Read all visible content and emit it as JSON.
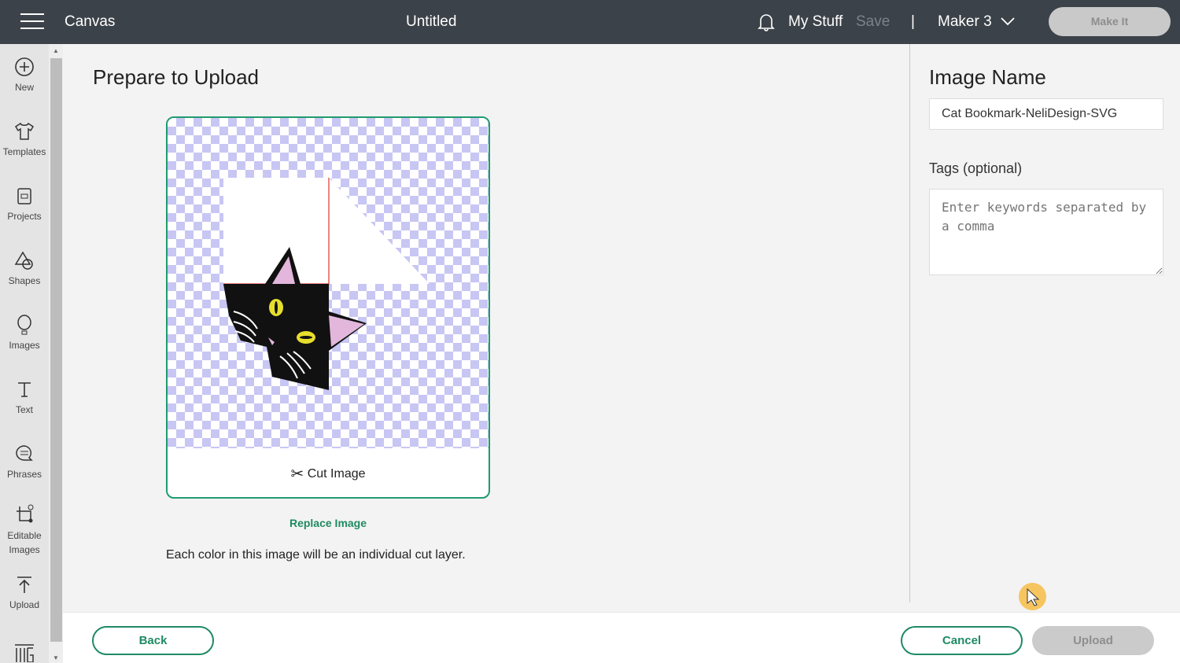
{
  "topbar": {
    "menu_icon": "hamburger-icon",
    "app": "Canvas",
    "title": "Untitled",
    "my_stuff": "My Stuff",
    "save": "Save",
    "separator": "|",
    "machine": "Maker 3",
    "make_it": "Make It"
  },
  "sidebar": {
    "items": [
      {
        "label": "New",
        "icon": "plus-circle-icon"
      },
      {
        "label": "Templates",
        "icon": "shirt-icon"
      },
      {
        "label": "Projects",
        "icon": "projects-icon"
      },
      {
        "label": "Shapes",
        "icon": "shapes-icon"
      },
      {
        "label": "Images",
        "icon": "balloon-icon"
      },
      {
        "label": "Text",
        "icon": "text-icon"
      },
      {
        "label": "Phrases",
        "icon": "speech-bubble-icon"
      },
      {
        "label": "Editable Images",
        "icon": "editable-icon"
      },
      {
        "label": "Upload",
        "icon": "upload-icon"
      }
    ]
  },
  "main": {
    "title": "Prepare to Upload",
    "cut_image": "Cut Image",
    "replace": "Replace Image",
    "description": "Each color in this image will be an individual cut layer."
  },
  "panel": {
    "name_label": "Image Name",
    "name_value": "Cat Bookmark-NeliDesign-SVG",
    "tags_label": "Tags (optional)",
    "tags_placeholder": "Enter keywords separated by a comma"
  },
  "footer": {
    "back": "Back",
    "cancel": "Cancel",
    "upload": "Upload"
  },
  "colors": {
    "accent": "#1f8a63",
    "topbar": "#3c4249"
  }
}
